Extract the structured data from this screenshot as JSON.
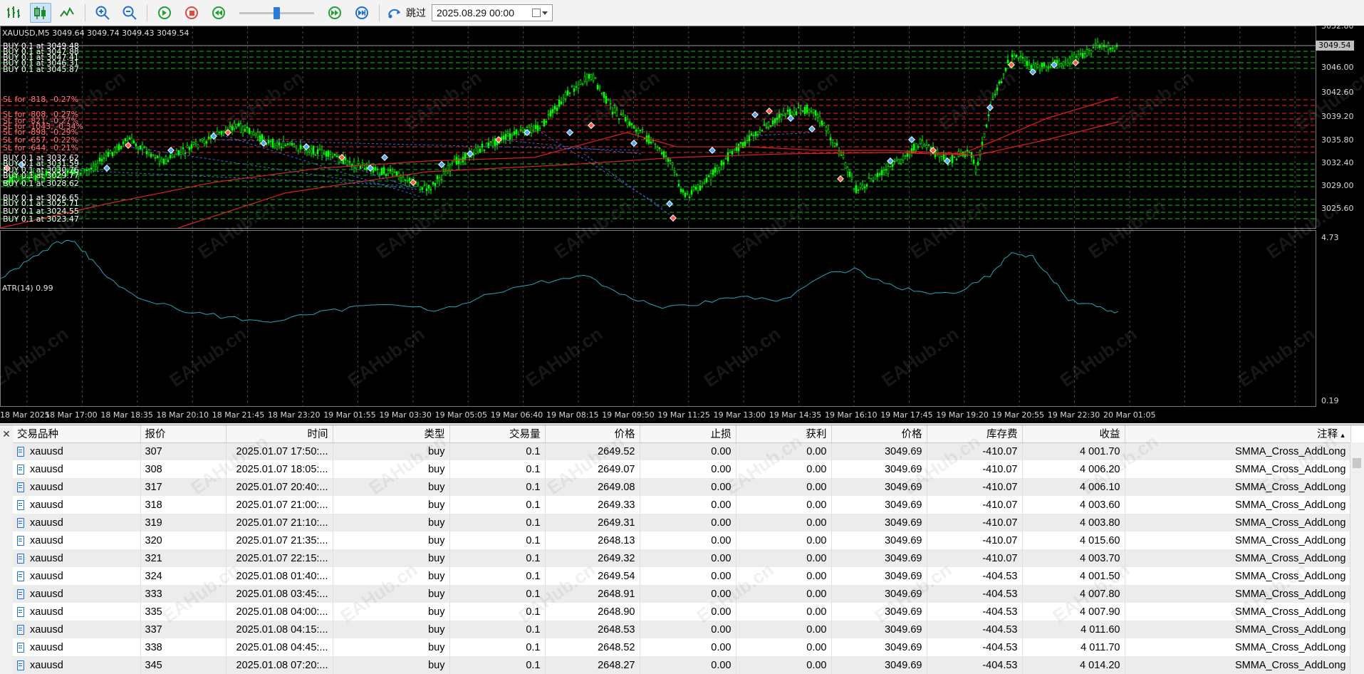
{
  "toolbar": {
    "skip_label": "跳过",
    "date_value": "2025.08.29 00:00",
    "speed_level": 0.5
  },
  "chart": {
    "title": "XAUUSD,M5  3049.64 3049.74 3049.43 3049.54",
    "atr_title": "ATR(14) 0.99",
    "current_price": "3049.54",
    "price_labels": [
      "3052.80",
      "3046.00",
      "3042.60",
      "3039.20",
      "3035.80",
      "3032.40",
      "3029.00",
      "3025.60"
    ],
    "atr_labels": [
      "4.73",
      "0.19"
    ],
    "time_labels": [
      "18 Mar 2025",
      "18 Mar 17:00",
      "18 Mar 18:35",
      "18 Mar 20:10",
      "18 Mar 21:45",
      "18 Mar 23:20",
      "19 Mar 01:55",
      "19 Mar 03:30",
      "19 Mar 05:05",
      "19 Mar 06:40",
      "19 Mar 08:15",
      "19 Mar 09:50",
      "19 Mar 11:25",
      "19 Mar 13:00",
      "19 Mar 14:35",
      "19 Mar 16:10",
      "19 Mar 17:45",
      "19 Mar 19:20",
      "19 Mar 20:55",
      "19 Mar 22:30",
      "20 Mar 01:05"
    ],
    "order_labels": [
      {
        "text": "BUY 0.1 at 3049.48",
        "kind": "buy"
      },
      {
        "text": "BUY 0.1 at 3047.88",
        "kind": "buy"
      },
      {
        "text": "BUY 0.1 at 3047.41",
        "kind": "buy"
      },
      {
        "text": "BUY 0.1 at 3046.31",
        "kind": "buy"
      },
      {
        "text": "BUY 0.1 at 3045.87",
        "kind": "buy"
      },
      {
        "text": "SL for -818, -0.27%",
        "kind": "sl"
      },
      {
        "text": "SL for -808, -0.27%",
        "kind": "sl"
      },
      {
        "text": "SL for -821, -0.27%",
        "kind": "sl"
      },
      {
        "text": "SL for -1043, -0.34%",
        "kind": "sl"
      },
      {
        "text": "SL for -898, -0.29%",
        "kind": "sl"
      },
      {
        "text": "SL for -657, -0.22%",
        "kind": "sl"
      },
      {
        "text": "SL for -644, -0.21%",
        "kind": "sl"
      },
      {
        "text": "BUY 0.1 at 3032.62",
        "kind": "buy"
      },
      {
        "text": "BUY 0.1 at 3031.59",
        "kind": "buy"
      },
      {
        "text": "BUY 0.1 at 3030.76",
        "kind": "buy"
      },
      {
        "text": "BUY 0.1 at 3029.77",
        "kind": "buy"
      },
      {
        "text": "BUY 0.1 at 3028.62",
        "kind": "buy"
      },
      {
        "text": "BUY 0.1 at 3026.65",
        "kind": "buy"
      },
      {
        "text": "BUY 0.1 at 3025.71",
        "kind": "buy"
      },
      {
        "text": "BUY 0.1 at 3024.55",
        "kind": "buy"
      },
      {
        "text": "BUY 0.1 at 3023.47",
        "kind": "buy"
      }
    ],
    "colors": {
      "background": "#000000",
      "candle": "#00ff00",
      "buy_line": "#00cc00",
      "sl_line": "#ff2020",
      "atr_line": "#1fa8b8",
      "ma_line": "#dd2020",
      "trade_link": "#3c64d8"
    }
  },
  "table": {
    "headers": [
      "交易品种",
      "报价",
      "时间",
      "类型",
      "交易量",
      "价格",
      "止损",
      "获利",
      "价格",
      "库存费",
      "收益",
      "注释"
    ],
    "rows": [
      [
        "xauusd",
        "307",
        "2025.01.07 17:50:...",
        "buy",
        "0.1",
        "2649.52",
        "0.00",
        "0.00",
        "3049.69",
        "-410.07",
        "4 001.70",
        "SMMA_Cross_AddLong"
      ],
      [
        "xauusd",
        "308",
        "2025.01.07 18:05:...",
        "buy",
        "0.1",
        "2649.07",
        "0.00",
        "0.00",
        "3049.69",
        "-410.07",
        "4 006.20",
        "SMMA_Cross_AddLong"
      ],
      [
        "xauusd",
        "317",
        "2025.01.07 20:40:...",
        "buy",
        "0.1",
        "2649.08",
        "0.00",
        "0.00",
        "3049.69",
        "-410.07",
        "4 006.10",
        "SMMA_Cross_AddLong"
      ],
      [
        "xauusd",
        "318",
        "2025.01.07 21:00:...",
        "buy",
        "0.1",
        "2649.33",
        "0.00",
        "0.00",
        "3049.69",
        "-410.07",
        "4 003.60",
        "SMMA_Cross_AddLong"
      ],
      [
        "xauusd",
        "319",
        "2025.01.07 21:10:...",
        "buy",
        "0.1",
        "2649.31",
        "0.00",
        "0.00",
        "3049.69",
        "-410.07",
        "4 003.80",
        "SMMA_Cross_AddLong"
      ],
      [
        "xauusd",
        "320",
        "2025.01.07 21:35:...",
        "buy",
        "0.1",
        "2648.13",
        "0.00",
        "0.00",
        "3049.69",
        "-410.07",
        "4 015.60",
        "SMMA_Cross_AddLong"
      ],
      [
        "xauusd",
        "321",
        "2025.01.07 22:15:...",
        "buy",
        "0.1",
        "2649.32",
        "0.00",
        "0.00",
        "3049.69",
        "-410.07",
        "4 003.70",
        "SMMA_Cross_AddLong"
      ],
      [
        "xauusd",
        "324",
        "2025.01.08 01:40:...",
        "buy",
        "0.1",
        "2649.54",
        "0.00",
        "0.00",
        "3049.69",
        "-404.53",
        "4 001.50",
        "SMMA_Cross_AddLong"
      ],
      [
        "xauusd",
        "333",
        "2025.01.08 03:45:...",
        "buy",
        "0.1",
        "2648.91",
        "0.00",
        "0.00",
        "3049.69",
        "-404.53",
        "4 007.80",
        "SMMA_Cross_AddLong"
      ],
      [
        "xauusd",
        "335",
        "2025.01.08 04:00:...",
        "buy",
        "0.1",
        "2648.90",
        "0.00",
        "0.00",
        "3049.69",
        "-404.53",
        "4 007.90",
        "SMMA_Cross_AddLong"
      ],
      [
        "xauusd",
        "337",
        "2025.01.08 04:15:...",
        "buy",
        "0.1",
        "2648.53",
        "0.00",
        "0.00",
        "3049.69",
        "-404.53",
        "4 011.60",
        "SMMA_Cross_AddLong"
      ],
      [
        "xauusd",
        "338",
        "2025.01.08 04:45:...",
        "buy",
        "0.1",
        "2648.52",
        "0.00",
        "0.00",
        "3049.69",
        "-404.53",
        "4 011.70",
        "SMMA_Cross_AddLong"
      ],
      [
        "xauusd",
        "345",
        "2025.01.08 07:20:...",
        "buy",
        "0.1",
        "2648.27",
        "0.00",
        "0.00",
        "3049.69",
        "-404.53",
        "4 014.20",
        "SMMA_Cross_AddLong"
      ]
    ]
  }
}
